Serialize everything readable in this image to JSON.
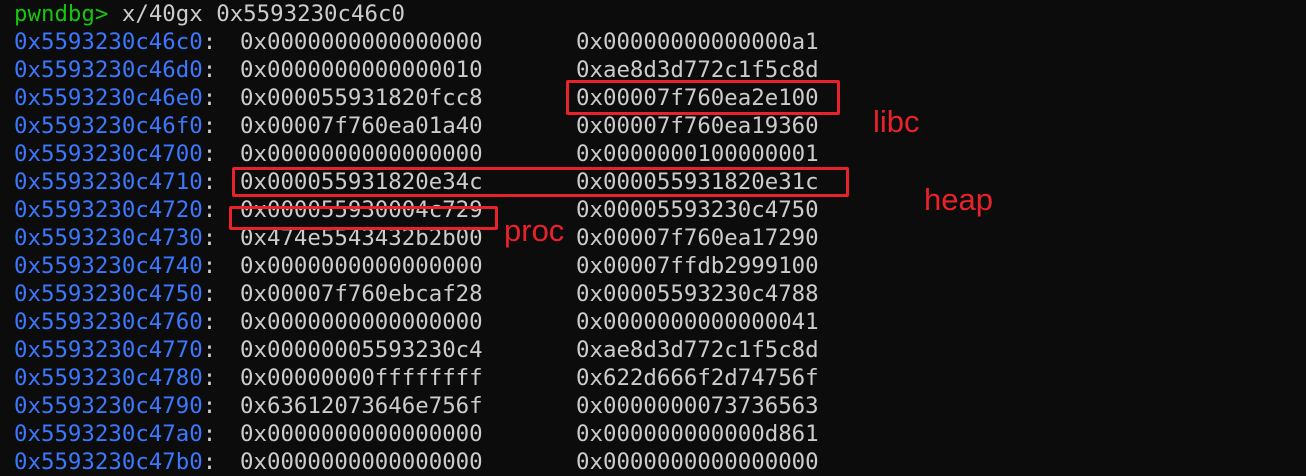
{
  "terminal": {
    "prompt": "pwndbg>",
    "command": " x/40gx 0x5593230c46c0",
    "rows": [
      {
        "addr": "0x5593230c46c0",
        "v1": "0x0000000000000000",
        "v2": "0x00000000000000a1"
      },
      {
        "addr": "0x5593230c46d0",
        "v1": "0x0000000000000010",
        "v2": "0xae8d3d772c1f5c8d"
      },
      {
        "addr": "0x5593230c46e0",
        "v1": "0x000055931820fcc8",
        "v2": "0x00007f760ea2e100"
      },
      {
        "addr": "0x5593230c46f0",
        "v1": "0x00007f760ea01a40",
        "v2": "0x00007f760ea19360"
      },
      {
        "addr": "0x5593230c4700",
        "v1": "0x0000000000000000",
        "v2": "0x0000000100000001"
      },
      {
        "addr": "0x5593230c4710",
        "v1": "0x000055931820e34c",
        "v2": "0x000055931820e31c"
      },
      {
        "addr": "0x5593230c4720",
        "v1": "0x000055930004c729",
        "v2": "0x00005593230c4750"
      },
      {
        "addr": "0x5593230c4730",
        "v1": "0x474e5543432b2b00",
        "v2": "0x00007f760ea17290"
      },
      {
        "addr": "0x5593230c4740",
        "v1": "0x0000000000000000",
        "v2": "0x00007ffdb2999100"
      },
      {
        "addr": "0x5593230c4750",
        "v1": "0x00007f760ebcaf28",
        "v2": "0x00005593230c4788"
      },
      {
        "addr": "0x5593230c4760",
        "v1": "0x0000000000000000",
        "v2": "0x0000000000000041"
      },
      {
        "addr": "0x5593230c4770",
        "v1": "0x00000005593230c4",
        "v2": "0xae8d3d772c1f5c8d"
      },
      {
        "addr": "0x5593230c4780",
        "v1": "0x00000000ffffffff",
        "v2": "0x622d666f2d74756f"
      },
      {
        "addr": "0x5593230c4790",
        "v1": "0x63612073646e756f",
        "v2": "0x0000000073736563"
      },
      {
        "addr": "0x5593230c47a0",
        "v1": "0x0000000000000000",
        "v2": "0x000000000000d861"
      },
      {
        "addr": "0x5593230c47b0",
        "v1": "0x0000000000000000",
        "v2": "0x0000000000000000"
      }
    ]
  },
  "annotations": {
    "libc": "libc",
    "heap": "heap",
    "proc": "proc"
  },
  "colors": {
    "background": "#0c0c0c",
    "prompt": "#16c60c",
    "address": "#3b78ff",
    "text": "#cccccc",
    "annotation": "#e8222a"
  }
}
